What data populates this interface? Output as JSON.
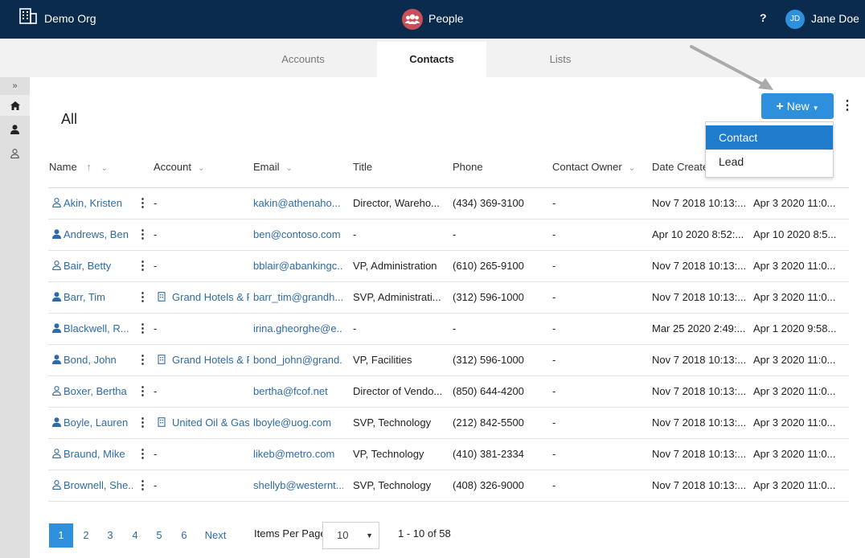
{
  "app": {
    "org_name": "Demo Org",
    "app_name": "People",
    "help_label": "?",
    "user_initials": "JD",
    "user_name": "Jane Doe"
  },
  "tabs": [
    {
      "label": "Accounts",
      "active": false
    },
    {
      "label": "Contacts",
      "active": true
    },
    {
      "label": "Lists",
      "active": false
    }
  ],
  "rail": {
    "expand": "»"
  },
  "list": {
    "title": "All",
    "new_button": "New",
    "new_menu": [
      "Contact",
      "Lead"
    ]
  },
  "columns": [
    "Name",
    "Account",
    "Email",
    "Title",
    "Phone",
    "Contact Owner",
    "Date Create",
    ""
  ],
  "rows": [
    {
      "name": "Akin, Kristen",
      "type": "lead",
      "account": "-",
      "email": "kakin@athenaho...",
      "title": "Director, Wareho...",
      "phone": "(434) 369-3100",
      "owner": "-",
      "created": "Nov 7 2018 10:13:...",
      "modified": "Apr 3 2020 11:0..."
    },
    {
      "name": "Andrews, Ben",
      "type": "contact",
      "account": "-",
      "email": "ben@contoso.com",
      "title": "-",
      "phone": "-",
      "owner": "-",
      "created": "Apr 10 2020 8:52:...",
      "modified": "Apr 10 2020 8:5..."
    },
    {
      "name": "Bair, Betty",
      "type": "lead",
      "account": "-",
      "email": "bblair@abankingc...",
      "title": "VP, Administration",
      "phone": "(610) 265-9100",
      "owner": "-",
      "created": "Nov 7 2018 10:13:...",
      "modified": "Apr 3 2020 11:0..."
    },
    {
      "name": "Barr, Tim",
      "type": "contact",
      "account": "Grand Hotels & R",
      "email": "barr_tim@grandh...",
      "title": "SVP, Administrati...",
      "phone": "(312) 596-1000",
      "owner": "-",
      "created": "Nov 7 2018 10:13:...",
      "modified": "Apr 3 2020 11:0..."
    },
    {
      "name": "Blackwell, R...",
      "type": "contact",
      "account": "-",
      "email": "irina.gheorghe@e...",
      "title": "-",
      "phone": "-",
      "owner": "-",
      "created": "Mar 25 2020 2:49:...",
      "modified": "Apr 1 2020 9:58..."
    },
    {
      "name": "Bond, John",
      "type": "contact",
      "account": "Grand Hotels & R",
      "email": "bond_john@grand...",
      "title": "VP, Facilities",
      "phone": "(312) 596-1000",
      "owner": "-",
      "created": "Nov 7 2018 10:13:...",
      "modified": "Apr 3 2020 11:0..."
    },
    {
      "name": "Boxer, Bertha",
      "type": "lead",
      "account": "-",
      "email": "bertha@fcof.net",
      "title": "Director of Vendo...",
      "phone": "(850) 644-4200",
      "owner": "-",
      "created": "Nov 7 2018 10:13:...",
      "modified": "Apr 3 2020 11:0..."
    },
    {
      "name": "Boyle, Lauren",
      "type": "contact",
      "account": "United Oil & Gas",
      "email": "lboyle@uog.com",
      "title": "SVP, Technology",
      "phone": "(212) 842-5500",
      "owner": "-",
      "created": "Nov 7 2018 10:13:...",
      "modified": "Apr 3 2020 11:0..."
    },
    {
      "name": "Braund, Mike",
      "type": "lead",
      "account": "-",
      "email": "likeb@metro.com",
      "title": "VP, Technology",
      "phone": "(410) 381-2334",
      "owner": "-",
      "created": "Nov 7 2018 10:13:...",
      "modified": "Apr 3 2020 11:0..."
    },
    {
      "name": "Brownell, She...",
      "type": "lead",
      "account": "-",
      "email": "shellyb@westernt...",
      "title": "SVP, Technology",
      "phone": "(408) 326-9000",
      "owner": "-",
      "created": "Nov 7 2018 10:13:...",
      "modified": "Apr 3 2020 11:0..."
    }
  ],
  "pagination": {
    "pages": [
      "1",
      "2",
      "3",
      "4",
      "5",
      "6"
    ],
    "active_page": "1",
    "next": "Next",
    "items_per_page_label": "Items Per Page",
    "items_per_page": "10",
    "range": "1 - 10 of 58"
  },
  "colors": {
    "topbar": "#0b2b4c",
    "accent": "#2e8fdc",
    "link": "#2f6ba8",
    "app_badge": "#c9505a"
  },
  "icons": {
    "org": "building-icon",
    "app": "people-icon",
    "home": "home-icon",
    "contact": "person-solid-icon",
    "lead": "person-outline-icon",
    "account": "building-small-icon",
    "sort_asc": "arrow-up-icon",
    "chevron": "chevron-down-icon",
    "more": "more-vertical-icon"
  }
}
